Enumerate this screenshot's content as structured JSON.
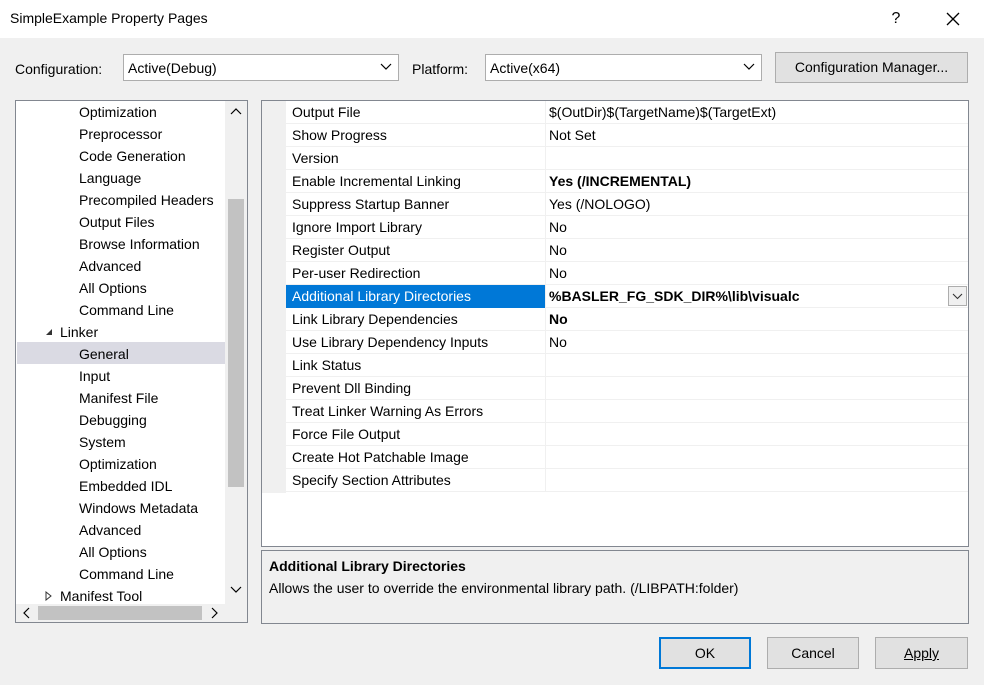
{
  "window": {
    "title": "SimpleExample Property Pages",
    "help_label": "?",
    "close_label": "✕"
  },
  "toolbar": {
    "configuration_label": "Configuration:",
    "configuration_value": "Active(Debug)",
    "platform_label": "Platform:",
    "platform_value": "Active(x64)",
    "config_manager_label": "Configuration Manager..."
  },
  "tree": {
    "items": [
      {
        "label": "Optimization",
        "level": 2
      },
      {
        "label": "Preprocessor",
        "level": 2
      },
      {
        "label": "Code Generation",
        "level": 2
      },
      {
        "label": "Language",
        "level": 2
      },
      {
        "label": "Precompiled Headers",
        "level": 2
      },
      {
        "label": "Output Files",
        "level": 2
      },
      {
        "label": "Browse Information",
        "level": 2
      },
      {
        "label": "Advanced",
        "level": 2
      },
      {
        "label": "All Options",
        "level": 2
      },
      {
        "label": "Command Line",
        "level": 2
      },
      {
        "label": "Linker",
        "level": 1,
        "expanded": true
      },
      {
        "label": "General",
        "level": 2,
        "selected": true
      },
      {
        "label": "Input",
        "level": 2
      },
      {
        "label": "Manifest File",
        "level": 2
      },
      {
        "label": "Debugging",
        "level": 2
      },
      {
        "label": "System",
        "level": 2
      },
      {
        "label": "Optimization",
        "level": 2
      },
      {
        "label": "Embedded IDL",
        "level": 2
      },
      {
        "label": "Windows Metadata",
        "level": 2
      },
      {
        "label": "Advanced",
        "level": 2
      },
      {
        "label": "All Options",
        "level": 2
      },
      {
        "label": "Command Line",
        "level": 2
      },
      {
        "label": "Manifest Tool",
        "level": 1,
        "expanded": false
      }
    ]
  },
  "properties": {
    "rows": [
      {
        "name": "Output File",
        "value": "$(OutDir)$(TargetName)$(TargetExt)"
      },
      {
        "name": "Show Progress",
        "value": "Not Set"
      },
      {
        "name": "Version",
        "value": ""
      },
      {
        "name": "Enable Incremental Linking",
        "value": "Yes (/INCREMENTAL)",
        "bold": true
      },
      {
        "name": "Suppress Startup Banner",
        "value": "Yes (/NOLOGO)"
      },
      {
        "name": "Ignore Import Library",
        "value": "No"
      },
      {
        "name": "Register Output",
        "value": "No"
      },
      {
        "name": "Per-user Redirection",
        "value": "No"
      },
      {
        "name": "Additional Library Directories",
        "value": "%BASLER_FG_SDK_DIR%\\lib\\visualc",
        "bold": true,
        "selected": true
      },
      {
        "name": "Link Library Dependencies",
        "value": "No",
        "bold": true
      },
      {
        "name": "Use Library Dependency Inputs",
        "value": "No"
      },
      {
        "name": "Link Status",
        "value": ""
      },
      {
        "name": "Prevent Dll Binding",
        "value": ""
      },
      {
        "name": "Treat Linker Warning As Errors",
        "value": ""
      },
      {
        "name": "Force File Output",
        "value": ""
      },
      {
        "name": "Create Hot Patchable Image",
        "value": ""
      },
      {
        "name": "Specify Section Attributes",
        "value": ""
      }
    ]
  },
  "description": {
    "title": "Additional Library Directories",
    "text": "Allows the user to override the environmental library path. (/LIBPATH:folder)"
  },
  "buttons": {
    "ok": "OK",
    "cancel": "Cancel",
    "apply": "Apply"
  },
  "colors": {
    "selection": "#0078d7",
    "tree_selection": "#dadae3"
  }
}
